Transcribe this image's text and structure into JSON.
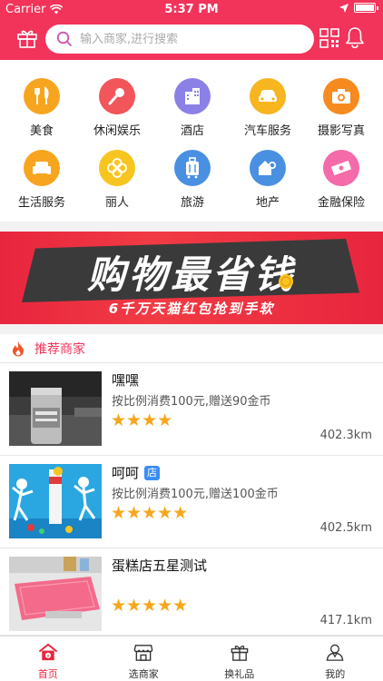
{
  "status_bar": {
    "carrier": "Carrier",
    "time": "5:37 PM"
  },
  "header": {
    "search_placeholder": "输入商家,进行搜索",
    "brand_color": "#f2335a"
  },
  "categories": [
    {
      "label": "美食",
      "icon": "fork-knife-icon",
      "color": "#f7a51f"
    },
    {
      "label": "休闲娱乐",
      "icon": "microphone-icon",
      "color": "#f2555a"
    },
    {
      "label": "酒店",
      "icon": "hotel-building-icon",
      "color": "#8a80e6"
    },
    {
      "label": "汽车服务",
      "icon": "car-icon",
      "color": "#f7b51f"
    },
    {
      "label": "摄影写真",
      "icon": "camera-icon",
      "color": "#f78a1f"
    },
    {
      "label": "生活服务",
      "icon": "sofa-icon",
      "color": "#f7a51f"
    },
    {
      "label": "丽人",
      "icon": "flower-icon",
      "color": "#f7c51f"
    },
    {
      "label": "旅游",
      "icon": "suitcase-icon",
      "color": "#4a90e2"
    },
    {
      "label": "地产",
      "icon": "house-key-icon",
      "color": "#4a90e2"
    },
    {
      "label": "金融保险",
      "icon": "money-icon",
      "color": "#f56aa8"
    }
  ],
  "banner": {
    "title": "购物最省钱",
    "subtitle": "6千万天猫红包抢到手软"
  },
  "recommended": {
    "title": "推荐商家",
    "merchants": [
      {
        "name": "嘿嘿",
        "tag": "",
        "desc": "按比例消费100元,赠送90金币",
        "stars": "★★★★",
        "distance": "402.3km"
      },
      {
        "name": "呵呵",
        "tag": "店",
        "desc": "按比例消费100元,赠送100金币",
        "stars": "★★★★★",
        "distance": "402.5km"
      },
      {
        "name": "蛋糕店五星测试",
        "tag": "",
        "desc": "",
        "stars": "★★★★★",
        "distance": "417.1km"
      }
    ]
  },
  "tabs": [
    {
      "label": "首页",
      "icon": "home-icon",
      "active": true
    },
    {
      "label": "选商家",
      "icon": "store-icon",
      "active": false
    },
    {
      "label": "换礼品",
      "icon": "gift-icon",
      "active": false
    },
    {
      "label": "我的",
      "icon": "person-icon",
      "active": false
    }
  ]
}
